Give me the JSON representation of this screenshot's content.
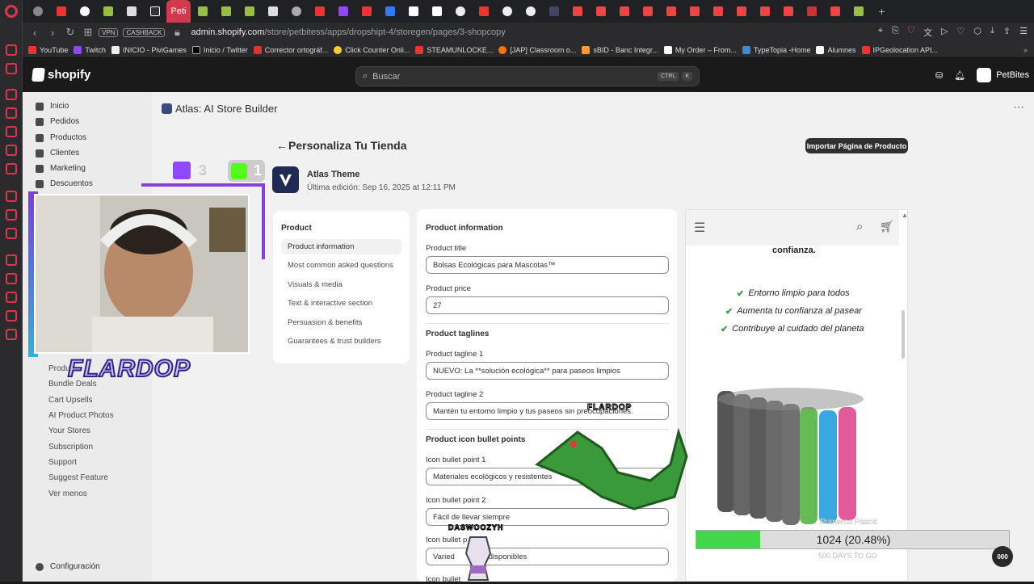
{
  "browser": {
    "active_tab_label": "Peti",
    "address": {
      "vpn": "VPN",
      "cashback": "CASHBACK",
      "host": "admin.shopify.com",
      "path": "/store/petbitess/apps/dropshipt-4/storegen/pages/3-shopcopy"
    },
    "bookmarks": [
      "YouTube",
      "Twitch",
      "INICIO - PiviGames",
      "Inicio / Twitter",
      "Corrector ortográf...",
      "Click Counter Onli...",
      "STEAMUNLOCKE...",
      "[JAP] Classroom o...",
      "sBID - Banc Integr...",
      "My Order – From...",
      "TypeTopia -Home",
      "Alumnes",
      "IPGeolocation API..."
    ]
  },
  "shopify": {
    "logo": "shopify",
    "search_placeholder": "Buscar",
    "kbd1": "CTRL",
    "kbd2": "K",
    "store_name": "PetBites"
  },
  "sidebar": {
    "items": [
      "Inicio",
      "Pedidos",
      "Productos",
      "Clientes",
      "Marketing",
      "Descuentos"
    ],
    "subitems": [
      "Produ",
      "Bundle Deals",
      "Cart Upsells",
      "AI Product Photos",
      "Your Stores",
      "Subscription",
      "Support",
      "Suggest Feature",
      "Ver menos"
    ],
    "settings": "Configuración"
  },
  "app": {
    "title": "Atlas: AI Store Builder",
    "page_title": "Personaliza Tu Tienda",
    "import_button": "Importar Página de Producto",
    "theme_name": "Atlas Theme",
    "theme_date": "Última edición: Sep 16, 2025 at 12:11 PM"
  },
  "nav": {
    "heading": "Product",
    "items": [
      "Product information",
      "Most common asked questions",
      "Visuals & media",
      "Text & interactive section",
      "Persuasion & benefits",
      "Guarantees & trust builders"
    ]
  },
  "form": {
    "section_info": "Product information",
    "title_label": "Product title",
    "title_value": "Bolsas Ecológicas para Mascotas™",
    "price_label": "Product price",
    "price_value": "27",
    "section_taglines": "Product taglines",
    "tagline1_label": "Product tagline 1",
    "tagline1_value": "NUEVO: La **solución ecológica** para paseos limpios",
    "tagline2_label": "Product tagline 2",
    "tagline2_value": "Mantén tu entorno limpio y tus paseos sin preocupaciones.",
    "section_bullets": "Product icon bullet points",
    "bullet1_label": "Icon bullet point 1",
    "bullet1_value": "Materiales ecológicos y resistentes",
    "bullet2_label": "Icon bullet point 2",
    "bullet2_value": "Fácil de llevar siempre",
    "bullet3_label": "Icon bullet p",
    "bullet3_value": "Varied",
    "bullet3_value_tail": "disponibles",
    "bullet4_label": "Icon bullet"
  },
  "preview": {
    "top_text": "confianza.",
    "checks": [
      "Entorno limpio para todos",
      "Aumenta tu confianza al pasear",
      "Contribuye al cuidado del planeta"
    ]
  },
  "stream": {
    "twitch_count": "3",
    "kick_count": "1",
    "streamer_name": "FLARDOP",
    "tag_flardop": "FLARDOP",
    "tag_daswoozy": "DASWOOZYH",
    "goal_text": "Primeros Pasos",
    "goal_progress_percent": 20.48,
    "goal_value": "1024 (20.48%)",
    "goal_footer": "500 DAYS TO GO",
    "badge": "000"
  },
  "colors": {
    "accent": "#303030",
    "browser_red": "#e0344b",
    "check_green": "#2ea043",
    "progress_green": "#44d64a"
  }
}
